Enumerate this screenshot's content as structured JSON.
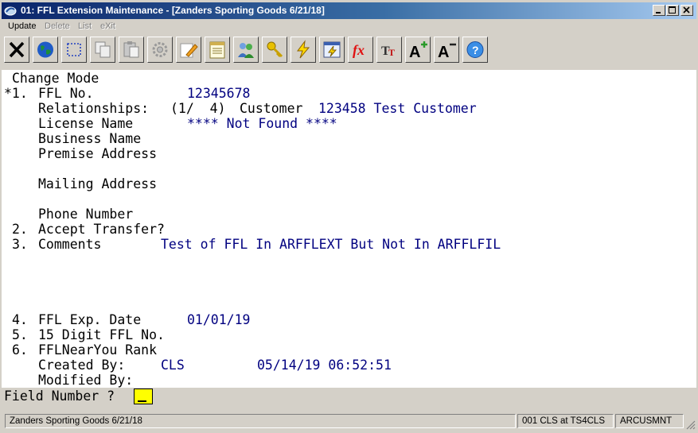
{
  "window": {
    "title": "01: FFL Extension Maintenance - [Zanders Sporting Goods 6/21/18]",
    "controls": {
      "minimize": "minimize",
      "maximize": "maximize",
      "close": "close"
    }
  },
  "menu": {
    "items": [
      {
        "label": "Update",
        "enabled": true
      },
      {
        "label": "Delete",
        "enabled": false
      },
      {
        "label": "List",
        "enabled": false
      },
      {
        "label": "eXit",
        "enabled": false
      }
    ]
  },
  "toolbar": {
    "icons": [
      "close-x-icon",
      "globe-icon",
      "select-box-icon",
      "copy-icon",
      "paste-icon",
      "gear-icon",
      "edit-pencil-icon",
      "notepad-icon",
      "users-icon",
      "key-icon",
      "lightning-icon",
      "window-lightning-icon",
      "function-fx-icon",
      "font-tt-icon",
      "font-increase-icon",
      "font-decrease-icon",
      "help-icon"
    ]
  },
  "screen": {
    "mode": "Change Mode",
    "f1": {
      "marker": "*1.",
      "label": "FFL No.",
      "value": "12345678"
    },
    "relationships": {
      "label": "Relationships:",
      "value": "(1/  4)",
      "customer_label": "Customer",
      "customer_value": "123458 Test Customer"
    },
    "license_name": {
      "label": "License Name",
      "value": "**** Not Found ****"
    },
    "business_name": {
      "label": "Business Name"
    },
    "premise_address": {
      "label": "Premise Address"
    },
    "mailing_address": {
      "label": "Mailing Address"
    },
    "phone_number": {
      "label": "Phone Number"
    },
    "f2": {
      "marker": "2.",
      "label": "Accept Transfer?"
    },
    "f3": {
      "marker": "3.",
      "label": "Comments",
      "value": "Test of FFL In ARFFLEXT But Not In ARFFLFIL"
    },
    "f4": {
      "marker": "4.",
      "label": "FFL Exp. Date",
      "value": "01/01/19"
    },
    "f5": {
      "marker": "5.",
      "label": "15 Digit FFL No."
    },
    "f6": {
      "marker": "6.",
      "label": "FFLNearYou Rank"
    },
    "created_by": {
      "label": "Created By:",
      "user": "CLS",
      "datetime": "05/14/19 06:52:51"
    },
    "modified_by": {
      "label": "Modified By:"
    }
  },
  "prompt": {
    "label": "Field Number ?"
  },
  "status": {
    "company": "Zanders Sporting Goods 6/21/18",
    "session": "001 CLS at TS4CLS",
    "program": "ARCUSMNT"
  }
}
